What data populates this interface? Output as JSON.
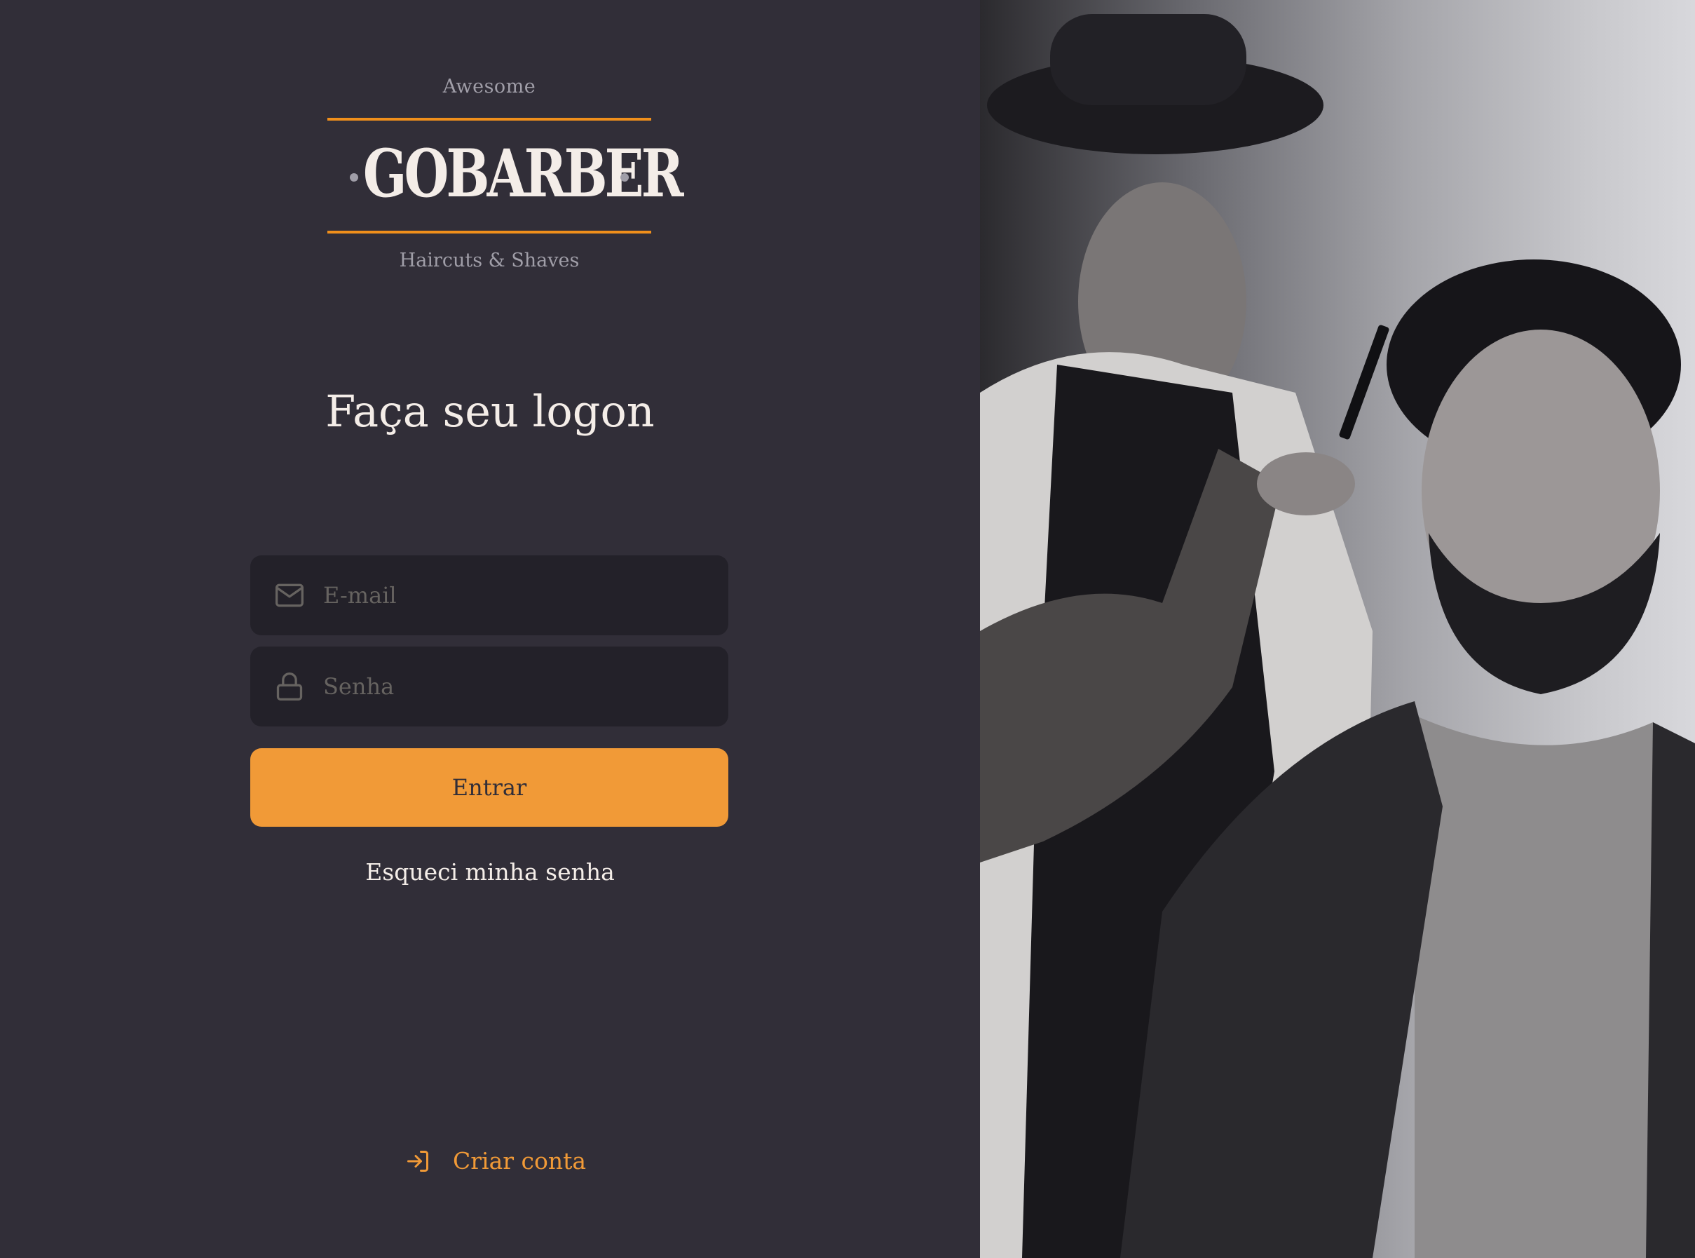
{
  "brand": {
    "top_text": "Awesome",
    "name": "GoBarber",
    "tagline": "Haircuts & Shaves",
    "accent_color": "#f19a37"
  },
  "form": {
    "title": "Faça seu logon",
    "email_placeholder": "E-mail",
    "password_placeholder": "Senha",
    "submit_label": "Entrar",
    "forgot_label": "Esqueci minha senha"
  },
  "footer": {
    "create_account_label": "Criar conta"
  },
  "icons": {
    "email": "mail-icon",
    "password": "lock-icon",
    "create_account": "log-in-icon"
  },
  "background_image": {
    "style": "black-and-white barbershop photo"
  }
}
